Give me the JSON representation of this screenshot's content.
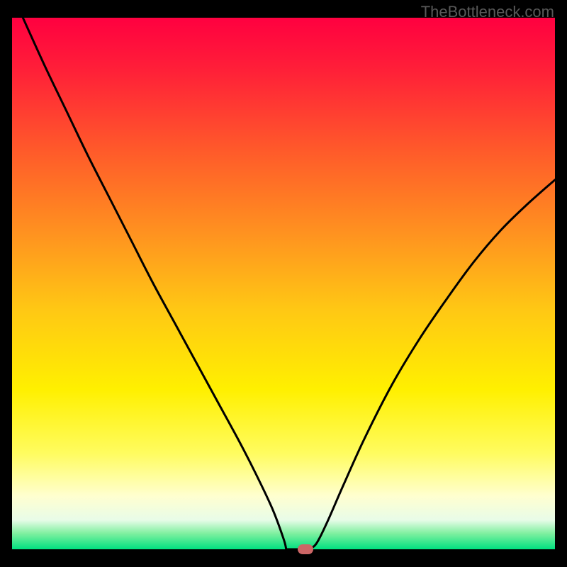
{
  "watermark": "TheBottleneck.com",
  "chart_data": {
    "type": "line",
    "title": "",
    "xlabel": "",
    "ylabel": "",
    "xlim": [
      0,
      1
    ],
    "ylim": [
      0,
      1
    ],
    "background_gradient_stops": [
      {
        "offset": 0.0,
        "color": "#ff0040"
      },
      {
        "offset": 0.1,
        "color": "#ff2038"
      },
      {
        "offset": 0.25,
        "color": "#ff5a2a"
      },
      {
        "offset": 0.4,
        "color": "#ff9020"
      },
      {
        "offset": 0.55,
        "color": "#ffc814"
      },
      {
        "offset": 0.7,
        "color": "#fff000"
      },
      {
        "offset": 0.82,
        "color": "#fffc60"
      },
      {
        "offset": 0.9,
        "color": "#ffffd0"
      },
      {
        "offset": 0.945,
        "color": "#e8fce8"
      },
      {
        "offset": 0.97,
        "color": "#80f0a0"
      },
      {
        "offset": 1.0,
        "color": "#00e080"
      }
    ],
    "series": [
      {
        "name": "bottleneck-curve",
        "x": [
          0.02,
          0.06,
          0.1,
          0.14,
          0.18,
          0.22,
          0.26,
          0.3,
          0.34,
          0.38,
          0.42,
          0.45,
          0.48,
          0.5,
          0.52,
          0.54,
          0.56,
          0.58,
          0.61,
          0.65,
          0.7,
          0.75,
          0.8,
          0.85,
          0.9,
          0.95,
          1.0
        ],
        "y": [
          1.0,
          0.91,
          0.825,
          0.74,
          0.66,
          0.58,
          0.5,
          0.425,
          0.35,
          0.275,
          0.2,
          0.14,
          0.075,
          0.02,
          0.0,
          0.0,
          0.01,
          0.05,
          0.12,
          0.21,
          0.31,
          0.395,
          0.47,
          0.54,
          0.6,
          0.65,
          0.695
        ]
      }
    ],
    "flat_segment": {
      "x_start": 0.505,
      "x_end": 0.545,
      "y": 0.0
    },
    "marker": {
      "x": 0.54,
      "y": 0.0,
      "color": "#cc6666"
    }
  }
}
